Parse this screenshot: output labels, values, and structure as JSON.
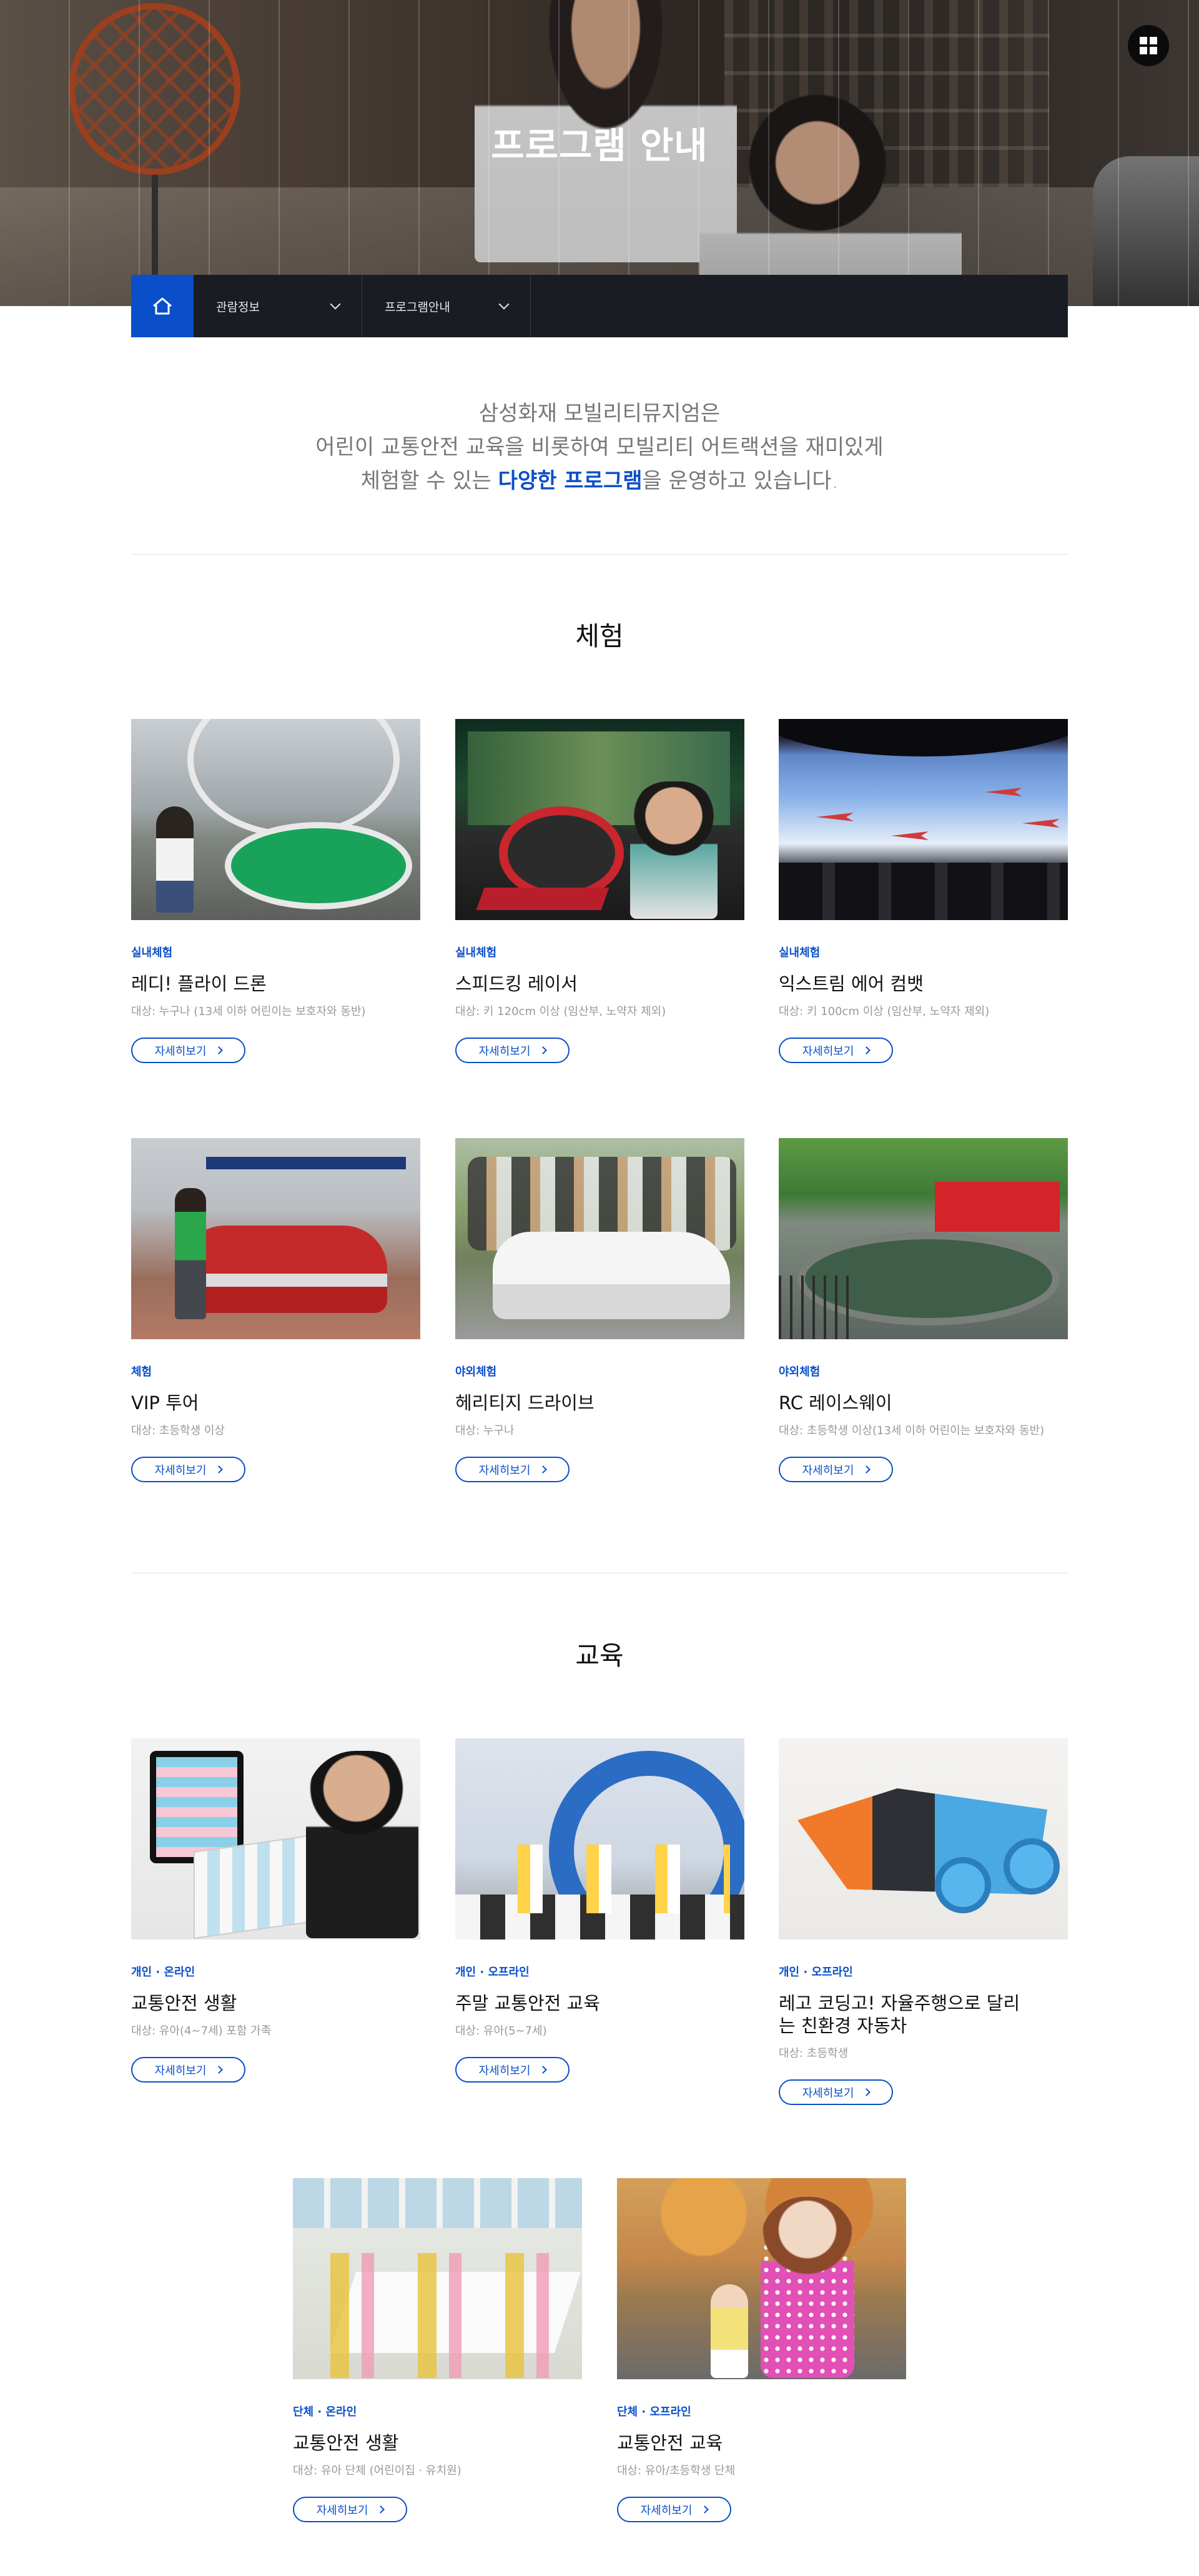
{
  "hero": {
    "title": "프로그램 안내"
  },
  "header": {
    "menu_icon": "grid-menu-icon"
  },
  "location_bar": {
    "home_icon": "home-icon",
    "dropdowns": [
      {
        "label": "관람정보"
      },
      {
        "label": "프로그램안내"
      }
    ]
  },
  "intro": {
    "line1": "삼성화재 모빌리티뮤지엄은",
    "line2": "어린이 교통안전 교육을 비롯하여 모빌리티 어트랙션을 재미있게",
    "line3_before": "체험할 수 있는 ",
    "line3_highlight": "다양한 프로그램",
    "line3_after": "을 운영하고 있습니다."
  },
  "sections": {
    "experience": {
      "title": "체험",
      "cards": [
        {
          "category": "실내체험",
          "title": "레디! 플라이 드론",
          "target": "대상: 누구나 (13세 이하 어린이는 보호자와 동반)",
          "more": "자세히보기"
        },
        {
          "category": "실내체험",
          "title": "스피드킹 레이서",
          "target": "대상: 키 120cm 이상 (임산부, 노약자 제외)",
          "more": "자세히보기"
        },
        {
          "category": "실내체험",
          "title": "익스트림 에어 컴뱃",
          "target": "대상: 키 100cm 이상 (임산부, 노약자 제외)",
          "more": "자세히보기"
        },
        {
          "category": "체험",
          "title": "VIP 투어",
          "target": "대상: 초등학생 이상",
          "more": "자세히보기"
        },
        {
          "category": "야외체험",
          "title": "헤리티지 드라이브",
          "target": "대상: 누구나",
          "more": "자세히보기"
        },
        {
          "category": "야외체험",
          "title": "RC 레이스웨이",
          "target": "대상: 초등학생 이상(13세 이하 어린이는 보호자와 동반)",
          "more": "자세히보기"
        }
      ]
    },
    "education": {
      "title": "교육",
      "cards": [
        {
          "category": "개인 · 온라인",
          "title": "교통안전 생활",
          "target": "대상: 유아(4~7세) 포함 가족",
          "more": "자세히보기"
        },
        {
          "category": "개인 · 오프라인",
          "title": "주말 교통안전 교육",
          "target": "대상: 유아(5~7세)",
          "more": "자세히보기"
        },
        {
          "category": "개인 · 오프라인",
          "title": "레고 코딩고! 자율주행으로 달리는 친환경 자동차",
          "target": "대상: 초등학생",
          "more": "자세히보기"
        },
        {
          "category": "단체 · 온라인",
          "title": "교통안전 생활",
          "target": "대상: 유아 단체 (어린이집 · 유치원)",
          "more": "자세히보기"
        },
        {
          "category": "단체 · 오프라인",
          "title": "교통안전 교육",
          "target": "대상: 유아/초등학생 단체",
          "more": "자세히보기"
        }
      ]
    }
  },
  "colors": {
    "accent": "#0a4fc9",
    "bar": "#1a1c23"
  }
}
